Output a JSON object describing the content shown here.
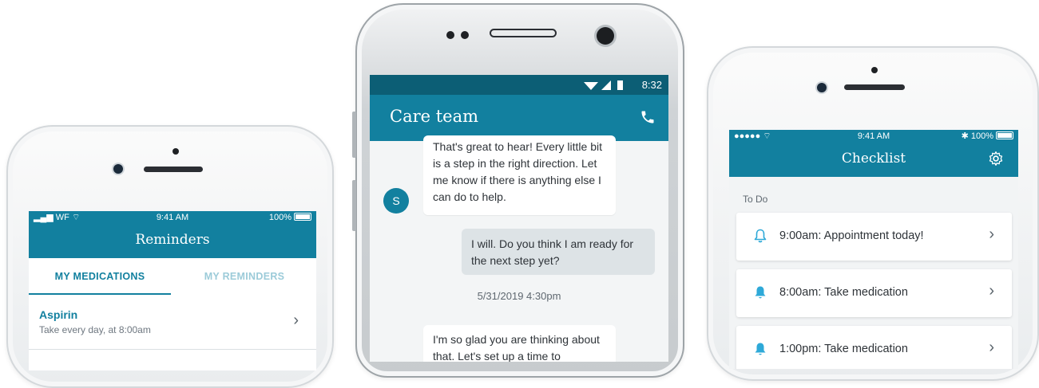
{
  "phone1": {
    "status": {
      "carrier": "WF",
      "time": "9:41 AM",
      "battery": "100%"
    },
    "header": {
      "title": "Reminders"
    },
    "tabs": [
      {
        "label": "MY MEDICATIONS",
        "active": true
      },
      {
        "label": "MY REMINDERS",
        "active": false
      }
    ],
    "medications": [
      {
        "name": "Aspirin",
        "schedule": "Take every day, at 8:00am"
      }
    ],
    "chevron": "›"
  },
  "phone2": {
    "status": {
      "time": "8:32"
    },
    "header": {
      "title": "Care team"
    },
    "messages": [
      {
        "from": "incoming",
        "avatar": "S",
        "text": "That's great to hear! Every little bit is a step in the right direction. Let me know if there is anything else I can do to help."
      },
      {
        "from": "outgoing",
        "text": "I will. Do you think I am ready for the next step yet?"
      },
      {
        "from": "timestamp",
        "text": "5/31/2019 4:30pm"
      },
      {
        "from": "incoming",
        "text": "I'm so glad you are thinking about that. Let's set up a time to"
      }
    ]
  },
  "phone3": {
    "status": {
      "time": "9:41 AM",
      "battery": "100%"
    },
    "header": {
      "title": "Checklist"
    },
    "section": "To Do",
    "items": [
      {
        "label": "9:00am: Appointment today!",
        "icon": "bell-outline-icon"
      },
      {
        "label": "8:00am: Take medication",
        "icon": "bell-filled-icon"
      },
      {
        "label": "1:00pm: Take medication",
        "icon": "bell-filled-icon"
      }
    ],
    "chevron": "›"
  },
  "colors": {
    "teal": "#12809f",
    "dark_teal": "#0c5e75",
    "bell": "#2ea9d8"
  }
}
